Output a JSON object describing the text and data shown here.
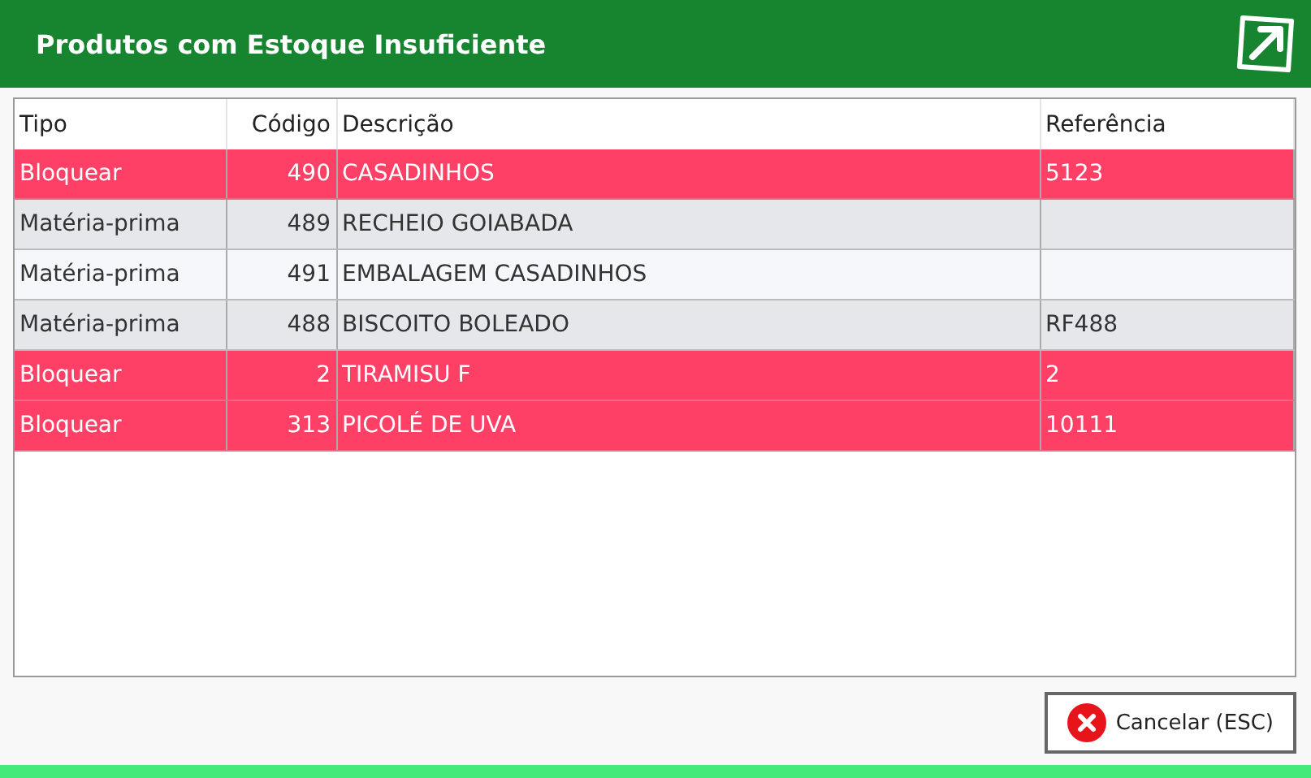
{
  "window": {
    "title": "Produtos com Estoque Insuficiente"
  },
  "table": {
    "columns": [
      "Tipo",
      "Código",
      "Descrição",
      "Referência"
    ],
    "rows": [
      {
        "kind": "blocked",
        "cells": [
          "Bloquear",
          "490",
          "CASADINHOS",
          "5123"
        ]
      },
      {
        "kind": "material",
        "cells": [
          "Matéria-prima",
          "489",
          "RECHEIO GOIABADA",
          ""
        ]
      },
      {
        "kind": "material",
        "cells": [
          "Matéria-prima",
          "491",
          "EMBALAGEM CASADINHOS",
          ""
        ]
      },
      {
        "kind": "material",
        "cells": [
          "Matéria-prima",
          "488",
          "BISCOITO BOLEADO",
          "RF488"
        ]
      },
      {
        "kind": "blocked",
        "cells": [
          "Bloquear",
          "2",
          "TIRAMISU F",
          "2"
        ]
      },
      {
        "kind": "blocked",
        "cells": [
          "Bloquear",
          "313",
          "PICOLÉ DE UVA",
          "10111"
        ]
      }
    ]
  },
  "buttons": [
    {
      "label": "Cancelar (ESC)"
    }
  ]
}
